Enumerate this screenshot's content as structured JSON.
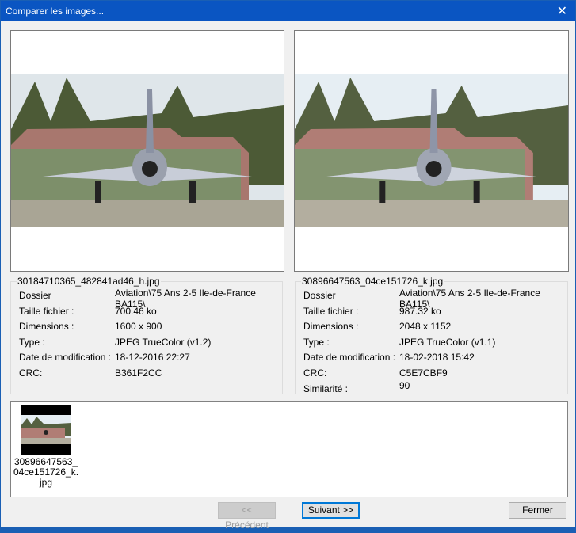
{
  "window": {
    "title": "Comparer les images...",
    "close_icon": "close-icon"
  },
  "left": {
    "filename": "30184710365_482841ad46_h.jpg",
    "labels": [
      "Dossier",
      "Taille fichier :",
      "Dimensions :",
      "Type :",
      "Date de modification :",
      "CRC:"
    ],
    "values": [
      "Aviation\\75 Ans 2-5 Ile-de-France BA115\\",
      "700.46 ko",
      "1600 x 900",
      "JPEG TrueColor (v1.2)",
      "18-12-2016 22:27",
      "B361F2CC"
    ]
  },
  "right": {
    "filename": "30896647563_04ce151726_k.jpg",
    "labels": [
      "Dossier",
      "Taille fichier :",
      "Dimensions :",
      "Type :",
      "Date de modification :",
      "CRC:",
      "Similarité :"
    ],
    "values": [
      "Aviation\\75 Ans 2-5 Ile-de-France BA115\\",
      "987.32 ko",
      "2048 x 1152",
      "JPEG TrueColor (v1.1)",
      "18-02-2018 15:42",
      "C5E7CBF9",
      "90"
    ]
  },
  "list": {
    "items": [
      {
        "caption": "30896647563_ 04ce151726_k. jpg"
      }
    ]
  },
  "buttons": {
    "previous": "<< Précédent",
    "next": "Suivant >>",
    "close": "Fermer"
  }
}
